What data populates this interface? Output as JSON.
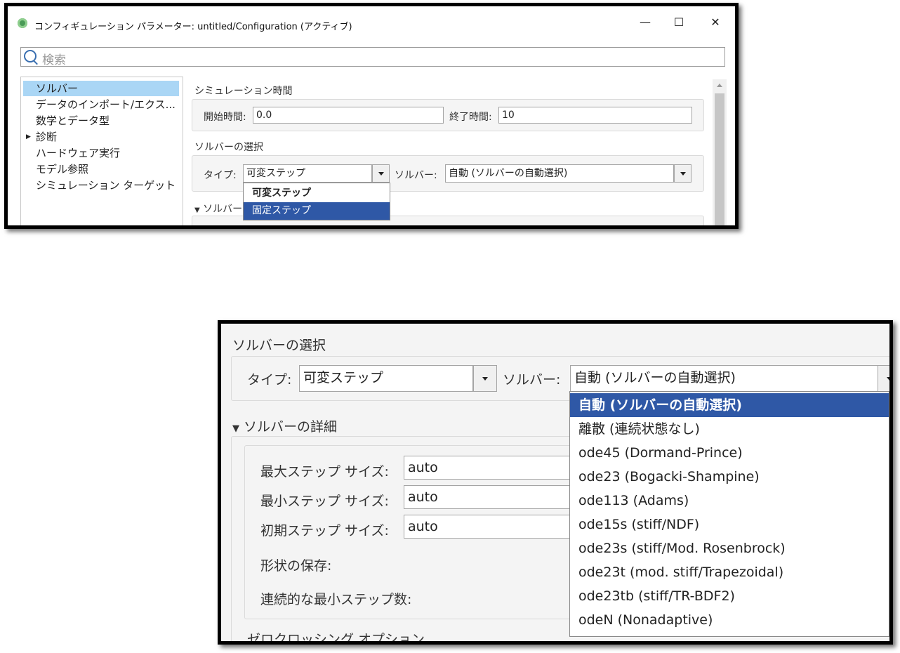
{
  "top": {
    "title": "コンフィギュレーション パラメーター: untitled/Configuration (アクティブ)",
    "search_placeholder": "検索",
    "nav": [
      "ソルバー",
      "データのインポート/エクス...",
      "数学とデータ型",
      "診断",
      "ハードウェア実行",
      "モデル参照",
      "シミュレーション ターゲット"
    ],
    "sim_time_label": "シミュレーション時間",
    "start_label": "開始時間:",
    "start_value": "0.0",
    "end_label": "終了時間:",
    "end_value": "10",
    "solver_select_label": "ソルバーの選択",
    "type_label": "タイプ:",
    "type_value": "可変ステップ",
    "solver_label": "ソルバー:",
    "solver_value": "自動 (ソルバーの自動選択)",
    "type_options": [
      "可変ステップ",
      "固定ステップ"
    ],
    "details_label": "ソルバー"
  },
  "bottom": {
    "solver_select_label": "ソルバーの選択",
    "type_label": "タイプ:",
    "type_value": "可変ステップ",
    "solver_label": "ソルバー:",
    "solver_value": "自動 (ソルバーの自動選択)",
    "details_label": "ソルバーの詳細",
    "max_step_label": "最大ステップ サイズ:",
    "max_step_value": "auto",
    "min_step_label": "最小ステップ サイズ:",
    "min_step_value": "auto",
    "init_step_label": "初期ステップ サイズ:",
    "init_step_value": "auto",
    "shape_label": "形状の保存:",
    "consec_label": "連続的な最小ステップ数:",
    "zero_cross_label": "ゼロクロッシング オプション",
    "solver_options": [
      "自動 (ソルバーの自動選択)",
      "離散 (連続状態なし)",
      "ode45 (Dormand-Prince)",
      "ode23 (Bogacki-Shampine)",
      "ode113 (Adams)",
      "ode15s (stiff/NDF)",
      "ode23s (stiff/Mod. Rosenbrock)",
      "ode23t (mod. stiff/Trapezoidal)",
      "ode23tb (stiff/TR-BDF2)",
      "odeN (Nonadaptive)"
    ]
  },
  "colors": {
    "selection": "#2f58a6",
    "nav_selection": "#aad6f5"
  }
}
